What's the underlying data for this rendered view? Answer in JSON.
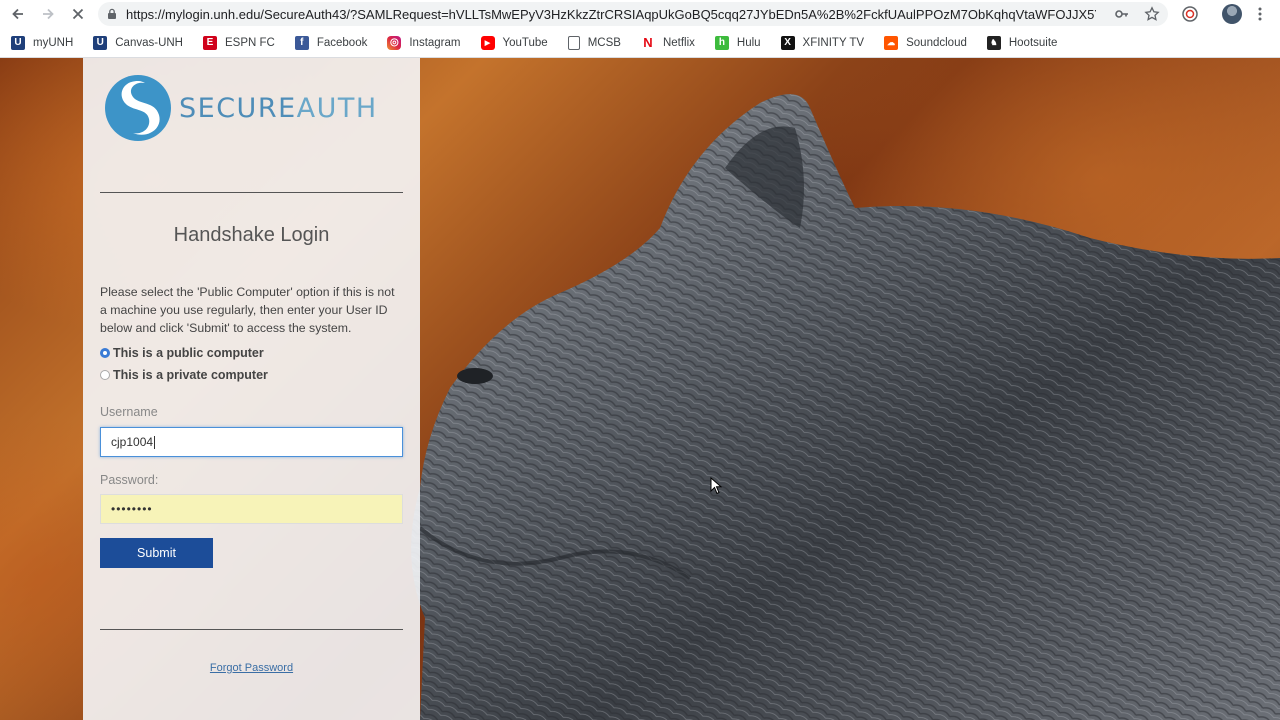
{
  "browser": {
    "url": "https://mylogin.unh.edu/SecureAuth43/?SAMLRequest=hVLLTsMwEPyV3HzKkzZtrCRSIAqpUkGoBQ5cqq27JYbEDn5A%2B%2FckfUAulPPOzM7ObKqhqVtaWFOJJX5Y1...",
    "bookmarks": [
      {
        "label": "myUNH",
        "icon": "shield-icon",
        "color": "#1f3f7a"
      },
      {
        "label": "Canvas-UNH",
        "icon": "shield-icon",
        "color": "#1f3f7a"
      },
      {
        "label": "ESPN FC",
        "icon": "espn-icon",
        "color": "#d0021b"
      },
      {
        "label": "Facebook",
        "icon": "facebook-icon",
        "color": "#3b5998"
      },
      {
        "label": "Instagram",
        "icon": "instagram-icon",
        "color": "#c13584"
      },
      {
        "label": "YouTube",
        "icon": "youtube-icon",
        "color": "#ff0000"
      },
      {
        "label": "MCSB",
        "icon": "page-icon",
        "color": "#5f6368"
      },
      {
        "label": "Netflix",
        "icon": "netflix-icon",
        "color": "#e50914"
      },
      {
        "label": "Hulu",
        "icon": "hulu-icon",
        "color": "#3dbb3d"
      },
      {
        "label": "XFINITY TV",
        "icon": "xfinity-icon",
        "color": "#111111"
      },
      {
        "label": "Soundcloud",
        "icon": "soundcloud-icon",
        "color": "#ff5500"
      },
      {
        "label": "Hootsuite",
        "icon": "hootsuite-icon",
        "color": "#222222"
      }
    ]
  },
  "login": {
    "logo_text_1": "SECURE",
    "logo_text_2": "AUTH",
    "title": "Handshake Login",
    "instructions": "Please select the 'Public Computer' option if this is not a machine you use regularly, then enter your User ID below and click 'Submit' to access the system.",
    "radio_public": "This is a public computer",
    "radio_private": "This is a private computer",
    "username_label": "Username",
    "username_value": "cjp1004",
    "password_label": "Password:",
    "password_value": "••••••••",
    "submit_label": "Submit",
    "forgot_label": "Forgot Password"
  }
}
